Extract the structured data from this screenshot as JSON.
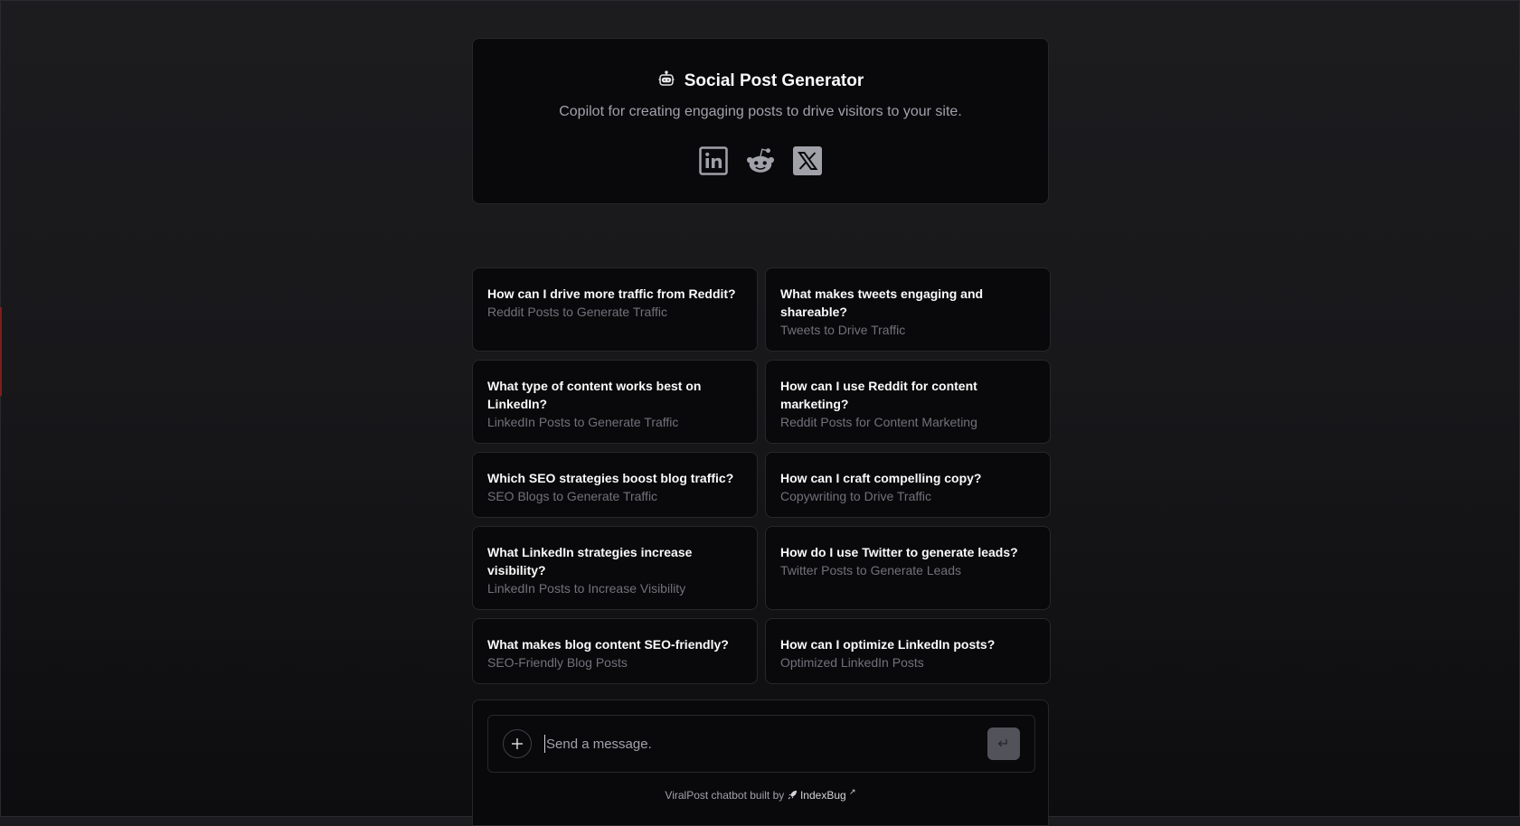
{
  "hero": {
    "title": "Social Post Generator",
    "subtitle": "Copilot for creating engaging posts to drive visitors to your site.",
    "icons": [
      "robot-icon",
      "linkedin-icon",
      "reddit-icon",
      "x-icon"
    ]
  },
  "suggestions": [
    {
      "question": "How can I drive more traffic from Reddit?",
      "subtitle": "Reddit Posts to Generate Traffic"
    },
    {
      "question": "What makes tweets engaging and shareable?",
      "subtitle": "Tweets to Drive Traffic"
    },
    {
      "question": "What type of content works best on LinkedIn?",
      "subtitle": "LinkedIn Posts to Generate Traffic"
    },
    {
      "question": "How can I use Reddit for content marketing?",
      "subtitle": "Reddit Posts for Content Marketing"
    },
    {
      "question": "Which SEO strategies boost blog traffic?",
      "subtitle": "SEO Blogs to Generate Traffic"
    },
    {
      "question": "How can I craft compelling copy?",
      "subtitle": "Copywriting to Drive Traffic"
    },
    {
      "question": "What LinkedIn strategies increase visibility?",
      "subtitle": "LinkedIn Posts to Increase Visibility"
    },
    {
      "question": "How do I use Twitter to generate leads?",
      "subtitle": "Twitter Posts to Generate Leads"
    },
    {
      "question": "What makes blog content SEO-friendly?",
      "subtitle": "SEO-Friendly Blog Posts"
    },
    {
      "question": "How can I optimize LinkedIn posts?",
      "subtitle": "Optimized LinkedIn Posts"
    }
  ],
  "composer": {
    "placeholder": "Send a message.",
    "send_symbol": "↵",
    "footer_text": "ViralPost chatbot built by",
    "footer_link": "IndexBug",
    "footer_arrow": "↗"
  },
  "colors": {
    "accent_bg": "#09090b",
    "border": "#27272a",
    "muted": "#71717a"
  }
}
